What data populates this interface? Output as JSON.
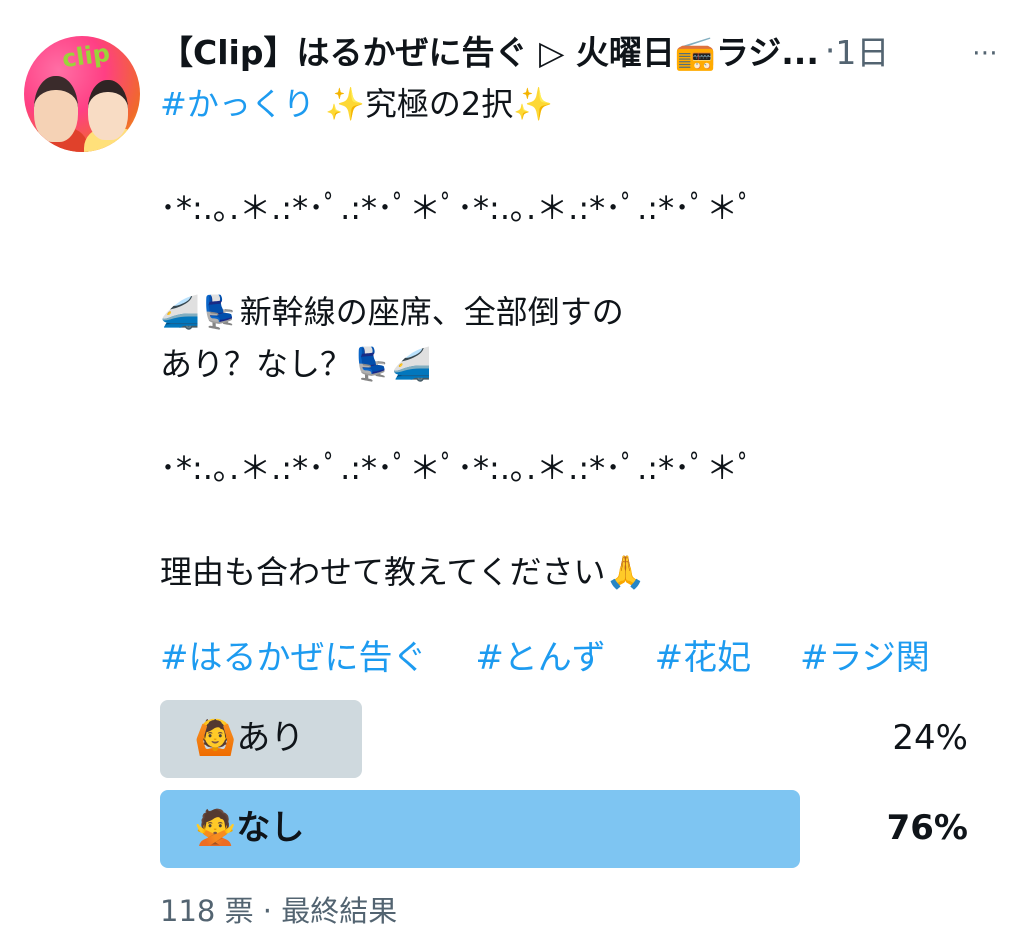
{
  "tweet": {
    "author": "【Clip】はるかぜに告ぐ ▷ 火曜日📻ラジ...",
    "separator": "·",
    "time": "1日",
    "more_icon": "⋯",
    "lines": [
      "#かっくり ✨究極の2択✨",
      "",
      "･*:.｡.＊.:*･ﾟ.:*･ﾟ＊ﾟ･*:.｡.＊.:*･ﾟ.:*･ﾟ＊ﾟ",
      "",
      "🚄💺新幹線の座席、全部倒すの",
      "あり？なし？💺🚄",
      "",
      "･*:.｡.＊.:*･ﾟ.:*･ﾟ＊ﾟ･*:.｡.＊.:*･ﾟ.:*･ﾟ＊ﾟ",
      "",
      "理由も合わせて教えてください🙏"
    ],
    "first_hashtag": "#かっくり",
    "first_line_rest": " ✨究極の2択✨",
    "hashtags": [
      "#はるかぜに告ぐ",
      "#とんず",
      "#花妃",
      "#ラジ関"
    ]
  },
  "poll": {
    "options": [
      {
        "label": "🙆あり",
        "percent": "24%",
        "value": 24,
        "winner": false
      },
      {
        "label": "🙅なし",
        "percent": "76%",
        "value": 76,
        "winner": true
      }
    ],
    "footer": "118 票 · 最終結果"
  },
  "colors": {
    "link": "#1d9bf0",
    "muted": "#536471",
    "bar_loser": "#cfd9de",
    "bar_winner": "#7ec5f2"
  }
}
